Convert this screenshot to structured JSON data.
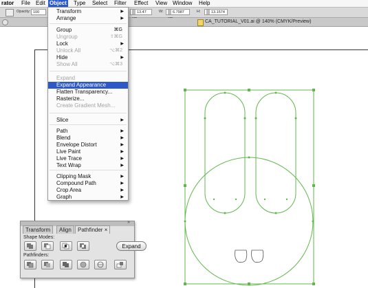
{
  "menubar": {
    "items": [
      "rator",
      "File",
      "Edit",
      "Object",
      "Type",
      "Select",
      "Filter",
      "Effect",
      "View",
      "Window",
      "Help"
    ]
  },
  "controlbar": {
    "opacity_label": "Opacity:",
    "opacity_value": "100",
    "x_value": "13.47 cm",
    "w_label": "W:",
    "w_value": "6.7987 cm",
    "h_label": "H:",
    "h_value": "13.1574"
  },
  "document": {
    "title": "CA_TUTORIAL_V01.ai @ 140% (CMYK/Preview)"
  },
  "object_menu": {
    "items": [
      {
        "label": "Transform",
        "submenu": true
      },
      {
        "label": "Arrange",
        "submenu": true
      },
      {
        "label": "Group",
        "shortcut": "⌘G"
      },
      {
        "label": "Ungroup",
        "shortcut": "⇧⌘G",
        "disabled": true
      },
      {
        "label": "Lock",
        "submenu": true
      },
      {
        "label": "Unlock All",
        "shortcut": "⌥⌘2",
        "disabled": true
      },
      {
        "label": "Hide",
        "submenu": true
      },
      {
        "label": "Show All",
        "shortcut": "⌥⌘3",
        "disabled": true
      },
      {
        "label": "Expand",
        "disabled": true
      },
      {
        "label": "Expand Appearance",
        "highlighted": true
      },
      {
        "label": "Flatten Transparency..."
      },
      {
        "label": "Rasterize..."
      },
      {
        "label": "Create Gradient Mesh...",
        "disabled": true
      },
      {
        "label": "Slice",
        "submenu": true
      },
      {
        "label": "Path",
        "submenu": true
      },
      {
        "label": "Blend",
        "submenu": true
      },
      {
        "label": "Envelope Distort",
        "submenu": true
      },
      {
        "label": "Live Paint",
        "submenu": true
      },
      {
        "label": "Live Trace",
        "submenu": true
      },
      {
        "label": "Text Wrap",
        "submenu": true
      },
      {
        "label": "Clipping Mask",
        "submenu": true
      },
      {
        "label": "Compound Path",
        "submenu": true
      },
      {
        "label": "Crop Area",
        "submenu": true
      },
      {
        "label": "Graph",
        "submenu": true
      }
    ]
  },
  "pathfinder_panel": {
    "tabs": [
      "Transform",
      "Align",
      "Pathfinder"
    ],
    "active_tab": "Pathfinder",
    "close_glyph": "×",
    "shape_modes_label": "Shape Modes:",
    "expand_label": "Expand",
    "pathfinders_label": "Pathfinders:"
  },
  "colors": {
    "selection_green": "#5fb84a",
    "menu_highlight": "#2e58c7"
  }
}
